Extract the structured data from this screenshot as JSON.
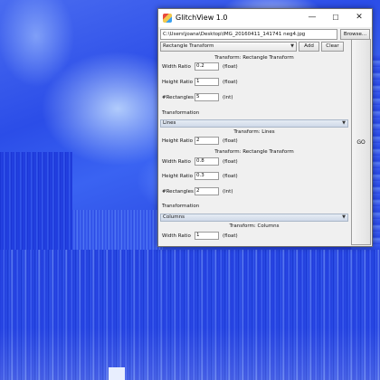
{
  "window": {
    "title": "GlitchView 1.0",
    "min_glyph": "—",
    "max_glyph": "☐",
    "close_glyph": "✕"
  },
  "file": {
    "path": "C:\\Users\\joana\\Desktop\\IMG_20160411_141741 neg4.jpg",
    "browse_label": "Browse..."
  },
  "transform_select": {
    "selected": "Rectangle Transform",
    "add_label": "Add",
    "clear_label": "Clear"
  },
  "go_label": "GO",
  "panels": {
    "rect1": {
      "title": "Transform: Rectangle Transform",
      "width_label": "Width Ratio",
      "width_value": "0.2",
      "width_type": "(float)",
      "height_label": "Height Ratio",
      "height_value": "1",
      "height_type": "(float)",
      "count_label": "#Rectangles",
      "count_value": "5",
      "count_type": "(int)",
      "section_label": "Transformation"
    },
    "lines": {
      "combo_value": "Lines",
      "title": "Transform: Lines",
      "height_label": "Height Ratio",
      "height_value": "2",
      "height_type": "(float)"
    },
    "rect2": {
      "title": "Transform: Rectangle Transform",
      "width_label": "Width Ratio",
      "width_value": "0.8",
      "width_type": "(float)",
      "height_label": "Height Ratio",
      "height_value": "0.3",
      "height_type": "(float)",
      "count_label": "#Rectangles",
      "count_value": "2",
      "count_type": "(int)",
      "section_label": "Transformation"
    },
    "columns": {
      "combo_value": "Columns",
      "title": "Transform: Columns",
      "width_label": "Width Ratio",
      "width_value": "1",
      "width_type": "(float)"
    }
  },
  "icons": {
    "app": "app-icon",
    "dropdown": "chevron-down-icon"
  },
  "colors": {
    "background_accent": "#1d35d8",
    "section_header": "#cfd9e8"
  }
}
